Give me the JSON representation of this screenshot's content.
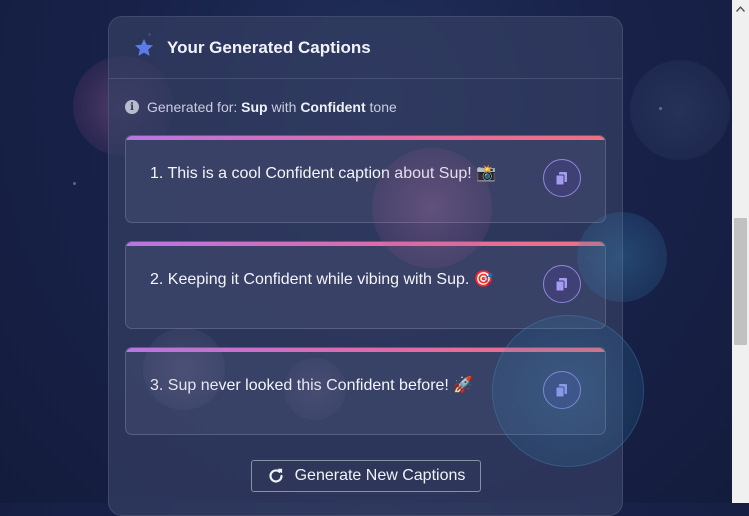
{
  "header": {
    "title": "Your Generated Captions",
    "icon": "star-icon"
  },
  "meta": {
    "prefix": "Generated for: ",
    "topic": "Sup",
    "middle": " with ",
    "tone": "Confident",
    "suffix": " tone"
  },
  "captions": [
    {
      "text": "1. This is a cool Confident caption about Sup! 📸"
    },
    {
      "text": "2. Keeping it Confident while vibing with Sup. 🎯"
    },
    {
      "text": "3. Sup never looked this Confident before! 🚀"
    }
  ],
  "actions": {
    "generate_label": "Generate New Captions"
  },
  "colors": {
    "accent": "#5b7be8",
    "gradient_start": "#b975e4",
    "gradient_end": "#f07080",
    "copy_border": "#8f86d8"
  }
}
